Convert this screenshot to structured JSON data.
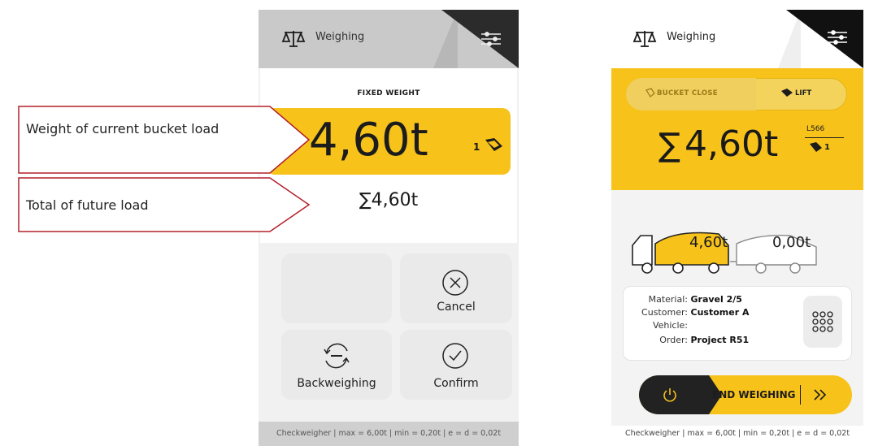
{
  "left_screen": {
    "header_title": "Weighing",
    "fixed_weight_label": "FIXED WEIGHT",
    "current_weight": "4,60t",
    "bucket_count": "1",
    "total_sum": "∑4,60t",
    "buttons": {
      "cancel": "Cancel",
      "backweighing": "Backweighing",
      "confirm": "Confirm"
    },
    "footer": "Checkweigher | max = 6,00t | min = 0,20t | e = d = 0,02t"
  },
  "callouts": {
    "current_bucket": "Weight of current bucket load",
    "future_total": "Total of future load"
  },
  "right_screen": {
    "header_title": "Weighing",
    "toggle": {
      "left": "BUCKET CLOSE",
      "right": "LIFT"
    },
    "sigma": "∑",
    "total_weight": "4,60t",
    "machine_id": "L566",
    "bucket_count": "1",
    "truck_weight": "4,60t",
    "trailer_weight": "0,00t",
    "info": [
      {
        "key": "Material:",
        "value": "Gravel 2/5"
      },
      {
        "key": "Customer:",
        "value": "Customer A"
      },
      {
        "key": "Vehicle:",
        "value": ""
      },
      {
        "key": "Order:",
        "value": "Project R51"
      }
    ],
    "end_button": "END WEIGHING",
    "footer": "Checkweigher | max = 6,00t | min = 0,20t | e = d = 0,02t"
  },
  "colors": {
    "accent": "#f7c21a",
    "dark": "#1c1c1c"
  }
}
